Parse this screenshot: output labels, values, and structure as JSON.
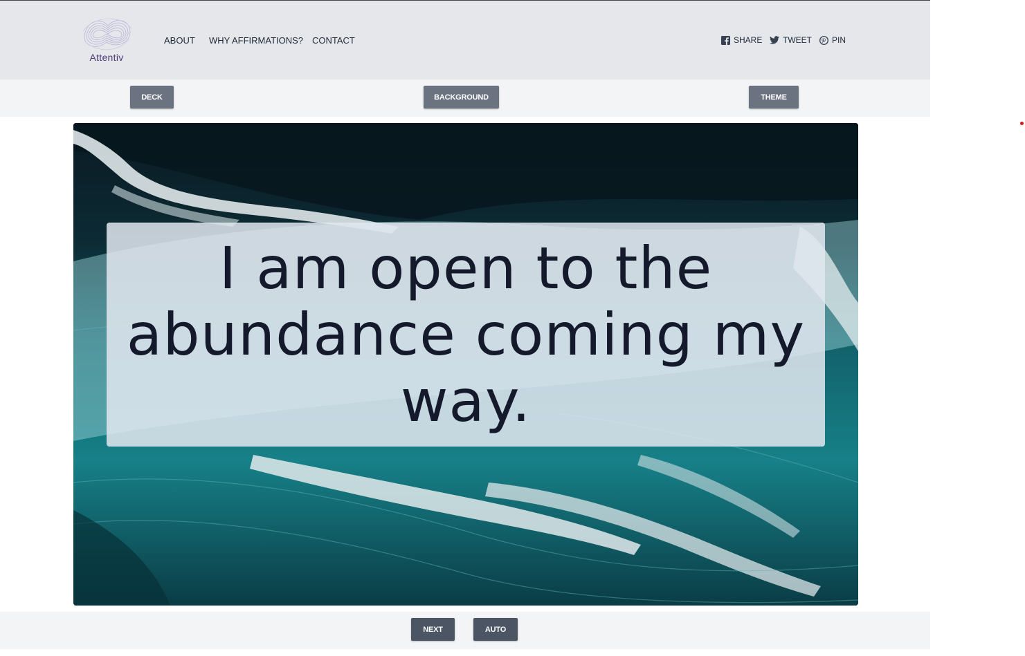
{
  "header": {
    "logo_text": "Attentiv",
    "nav": [
      {
        "label": "ABOUT"
      },
      {
        "label": "WHY AFFIRMATIONS?"
      },
      {
        "label": "CONTACT"
      }
    ],
    "share": [
      {
        "label": "SHARE",
        "icon": "facebook-icon"
      },
      {
        "label": "TWEET",
        "icon": "twitter-icon"
      },
      {
        "label": "PIN",
        "icon": "pinterest-icon"
      }
    ]
  },
  "toolbar": {
    "deck_label": "DECK",
    "background_label": "BACKGROUND",
    "theme_label": "THEME"
  },
  "card": {
    "affirmation": "I am open to the abundance coming my way.",
    "background": "teal ocean waves"
  },
  "controls": {
    "next_label": "NEXT",
    "auto_label": "AUTO"
  },
  "colors": {
    "header_bg": "#e5e7eb",
    "toolbar_bg": "#f3f4f6",
    "button_bg": "#6b7280",
    "text_dark": "#141a2b",
    "logo_purple": "#4c3a78"
  }
}
